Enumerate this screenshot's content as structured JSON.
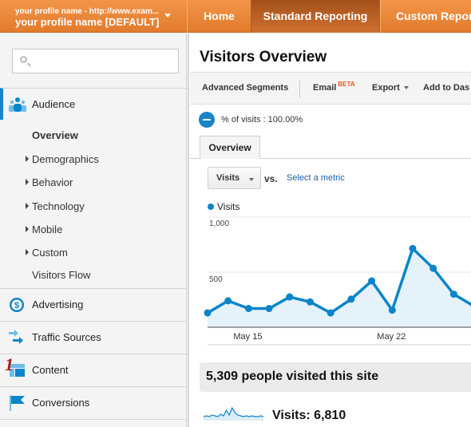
{
  "header": {
    "profile_line1": "your profile name - http://www.exam...",
    "profile_line2": "your profile name [DEFAULT]",
    "nav": [
      {
        "label": "Home",
        "active": false
      },
      {
        "label": "Standard Reporting",
        "active": true
      },
      {
        "label": "Custom Reports",
        "active": false
      }
    ],
    "nav_visible": [
      "Home",
      "Standard Reporting",
      "Custom Report"
    ]
  },
  "sidebar": {
    "search_placeholder": "",
    "sections": [
      {
        "label": "Audience",
        "icon": "audience-icon",
        "active": true
      },
      {
        "label": "Advertising",
        "icon": "dollar-icon"
      },
      {
        "label": "Traffic Sources",
        "icon": "arrows-icon"
      },
      {
        "label": "Content",
        "icon": "content-icon"
      },
      {
        "label": "Conversions",
        "icon": "flag-icon"
      }
    ],
    "audience_items": [
      {
        "label": "Overview",
        "selected": true,
        "expandable": false
      },
      {
        "label": "Demographics",
        "expandable": true
      },
      {
        "label": "Behavior",
        "expandable": true
      },
      {
        "label": "Technology",
        "expandable": true
      },
      {
        "label": "Mobile",
        "expandable": true
      },
      {
        "label": "Custom",
        "expandable": true
      },
      {
        "label": "Visitors Flow",
        "expandable": false
      }
    ],
    "annotation_marker": "1"
  },
  "main": {
    "title": "Visitors Overview",
    "toolbar": {
      "advanced_segments": "Advanced Segments",
      "email": "Email",
      "beta": "BETA",
      "export": "Export",
      "add_to_dashboard": "Add to Das"
    },
    "segment": "% of visits : 100.00%",
    "tab": "Overview",
    "metric_select": "Visits",
    "vs": "vs.",
    "select_metric": "Select a metric",
    "summary": "5,309 people visited this site",
    "visits_total": "Visits: 6,810"
  },
  "colors": {
    "brand_orange": "#e88336",
    "accent_blue": "#0a85c9",
    "link_blue": "#1a5ea8"
  },
  "chart_data": {
    "type": "area",
    "legend": [
      "Visits"
    ],
    "series": [
      {
        "name": "Visits",
        "values": [
          130,
          240,
          170,
          170,
          275,
          230,
          130,
          255,
          420,
          155,
          715,
          535,
          300,
          190
        ]
      }
    ],
    "x_tick_labels": [
      {
        "label": "May 15",
        "index": 2
      },
      {
        "label": "May 22",
        "index": 9
      }
    ],
    "y_tick_labels": [
      "1,000",
      "500"
    ],
    "ylim": [
      0,
      1000
    ],
    "grid": true
  }
}
